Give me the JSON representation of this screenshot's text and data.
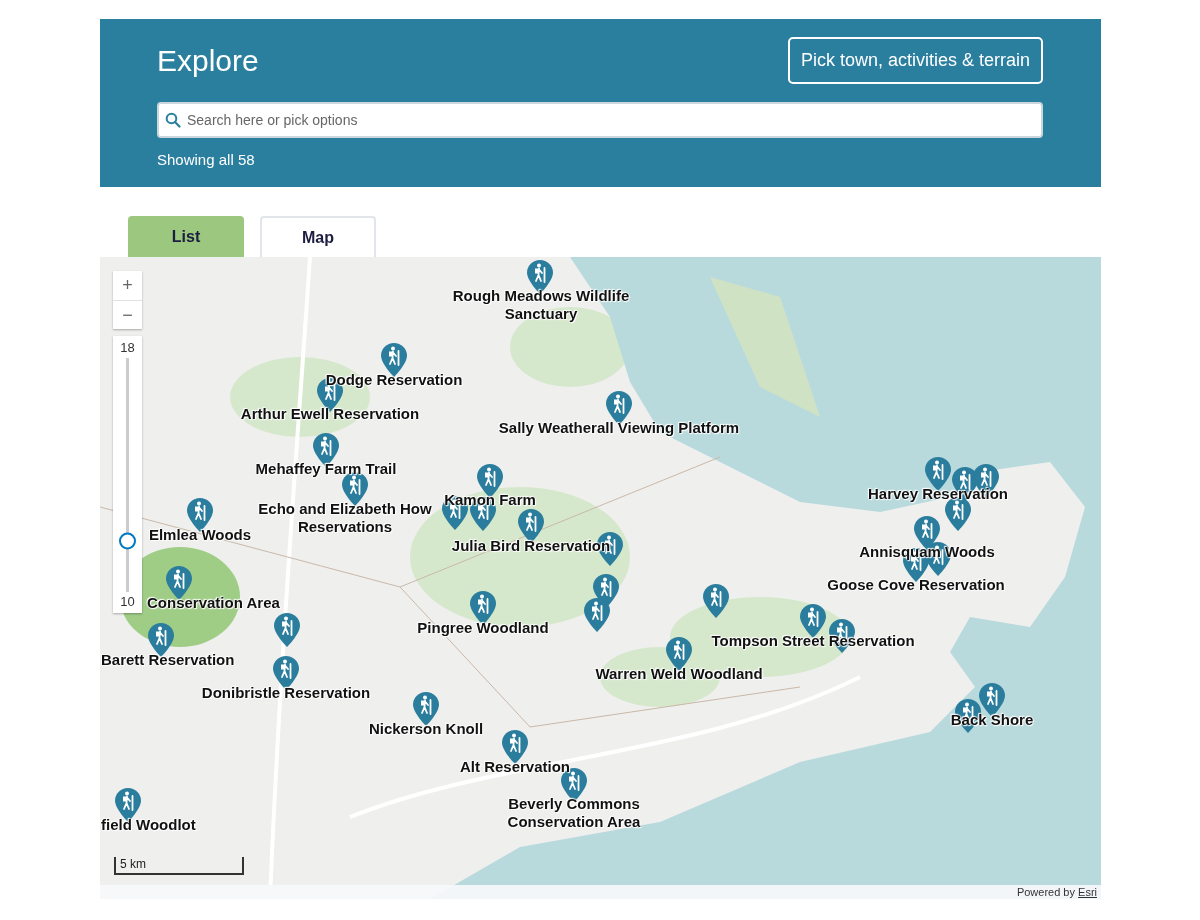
{
  "header": {
    "title": "Explore",
    "filter_button": "Pick town, activities & terrain",
    "search": {
      "placeholder": "Search here or pick options"
    },
    "result_count": "Showing all 58"
  },
  "tabs": [
    {
      "label": "List",
      "selected": false
    },
    {
      "label": "Map",
      "selected": true
    }
  ],
  "map": {
    "zoom_in": "+",
    "zoom_out": "−",
    "zoom_slider": {
      "max_label": "18",
      "min_label": "10",
      "level": 0.22
    },
    "markers": [
      {
        "label": "Rough Meadows Wildlife Sanctuary"
      },
      {
        "label": "Dodge Reservation"
      },
      {
        "label": "Arthur Ewell Reservation"
      },
      {
        "label": "Sally Weatherall Viewing Platform"
      },
      {
        "label": "Mehaffey Farm Trail"
      },
      {
        "label": "Kamon Farm"
      },
      {
        "label": "Echo and Elizabeth How Reservations"
      },
      {
        "label": "Harvey Reservation"
      },
      {
        "label": "Elmlea Woods"
      },
      {
        "label": "Julia Bird Reservation"
      },
      {
        "label": "Annisquam Woods"
      },
      {
        "label": "Goose Cove Reservation"
      },
      {
        "label": "Conservation Area"
      },
      {
        "label": "Pingree Woodland"
      },
      {
        "label": "Tompson Street Reservation"
      },
      {
        "label": "Barett Reservation"
      },
      {
        "label": "Warren Weld Woodland"
      },
      {
        "label": "Donibristle Reservation"
      },
      {
        "label": "Back Shore"
      },
      {
        "label": "Nickerson Knoll"
      },
      {
        "label": "Alt Reservation"
      },
      {
        "label": "field Woodlot"
      },
      {
        "label": "Beverly Commons Conservation Area"
      }
    ],
    "scale": "5 km",
    "attribution": {
      "text": "Powered by",
      "link": "Esri"
    }
  }
}
